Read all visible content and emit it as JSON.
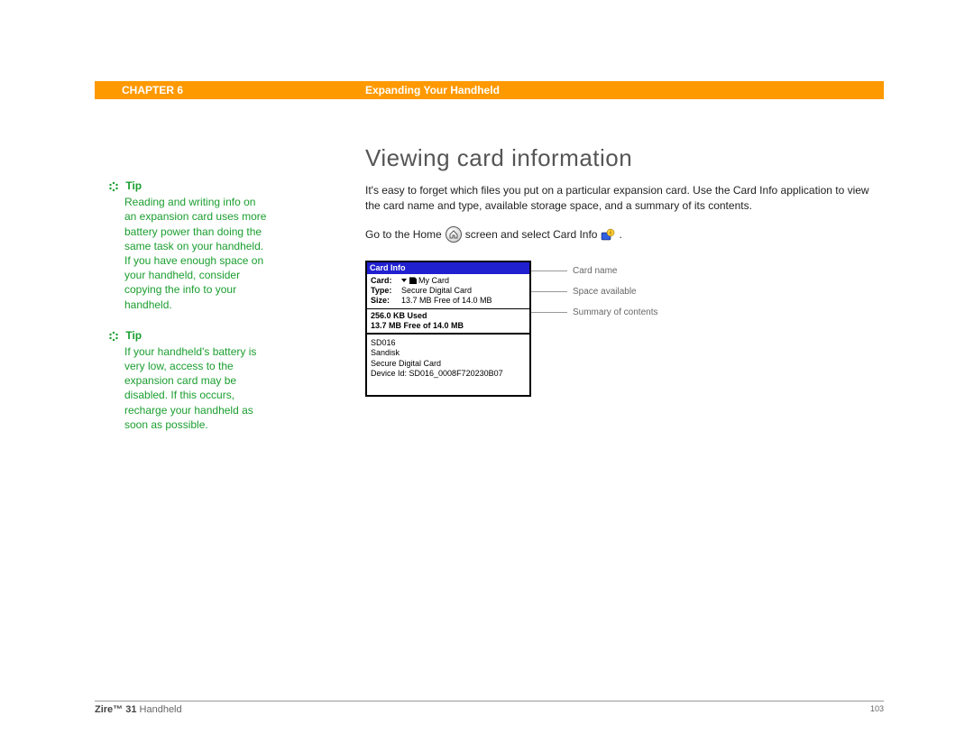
{
  "header": {
    "chapter": "CHAPTER 6",
    "section": "Expanding Your Handheld"
  },
  "tips": [
    {
      "label": "Tip",
      "body": "Reading and writing info on an expansion card uses more battery power than doing the same task on your handheld. If you have enough space on your handheld, consider copying the info to your handheld."
    },
    {
      "label": "Tip",
      "body": "If your handheld's battery is very low, access to the expansion card may be disabled. If this occurs, recharge your handheld as soon as possible."
    }
  ],
  "main": {
    "heading": "Viewing card information",
    "intro": "It's easy to forget which files you put on a particular expansion card. Use the Card Info application to view the card name and type, available storage space, and a summary of its contents.",
    "goto_pre": "Go to the Home",
    "goto_mid": "screen and select Card Info",
    "goto_post": "."
  },
  "cardinfo": {
    "title": "Card Info",
    "card_label": "Card:",
    "card_value": "My Card",
    "type_label": "Type:",
    "type_value": "Secure Digital Card",
    "size_label": "Size:",
    "size_value": "13.7 MB Free of 14.0 MB",
    "used": "256.0 KB Used",
    "free": "13.7 MB Free of 14.0 MB",
    "detail_1": "SD016",
    "detail_2": "Sandisk",
    "detail_3": "Secure Digital Card",
    "detail_4": "Device Id: SD016_0008F720230B07"
  },
  "callouts": {
    "name": "Card name",
    "space": "Space available",
    "summary": "Summary of contents"
  },
  "footer": {
    "product_bold": "Zire™ 31",
    "product_rest": " Handheld",
    "page": "103"
  }
}
